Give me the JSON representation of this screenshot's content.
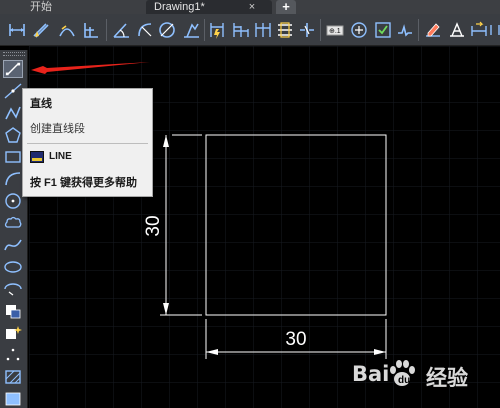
{
  "tabs": {
    "start_label": "开始",
    "drawing_label": "Drawing1*",
    "close_glyph": "×",
    "new_glyph": "+"
  },
  "toolbar": {
    "icons": [
      "linear-dim-icon",
      "aligned-dim-icon",
      "arc-length-icon",
      "ordinate-dim-icon",
      "angular-dim-icon",
      "radius-dim-icon",
      "diameter-dim-icon",
      "jogged-dim-icon",
      "quick-dim-icon",
      "baseline-dim-icon",
      "continue-dim-icon",
      "dim-space-icon",
      "dim-break-icon",
      "tolerance-icon",
      "center-mark-icon",
      "inspection-icon",
      "jogged-linear-icon",
      "dim-edit-icon",
      "dim-text-edit-icon",
      "dim-update-icon",
      "dim-style-icon"
    ]
  },
  "left_tools": {
    "icons": [
      "line-icon",
      "construction-line-icon",
      "polyline-icon",
      "polygon-icon",
      "rectangle-icon",
      "arc-icon",
      "circle-icon",
      "revision-cloud-icon",
      "spline-icon",
      "ellipse-icon",
      "ellipse-arc-icon",
      "insert-block-icon",
      "make-block-icon",
      "point-icon",
      "hatch-icon",
      "gradient-icon",
      "region-icon"
    ]
  },
  "tooltip": {
    "title": "直线",
    "description": "创建直线段",
    "command": "LINE",
    "help": "按 F1 键获得更多帮助"
  },
  "drawing": {
    "vertical_dimension": "30",
    "horizontal_dimension": "30"
  },
  "watermark": {
    "brand_left": "Bai",
    "brand_right": "经验"
  },
  "colors": {
    "canvas": "#000000",
    "geometry": "#ffffff",
    "callout_arrow": "#e8231b",
    "grid_dot": "#2a2f3a"
  }
}
